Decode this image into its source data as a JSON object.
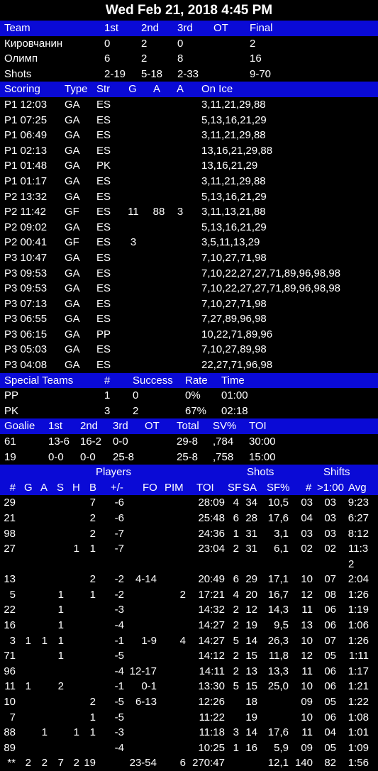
{
  "title": "Wed Feb 21, 2018 4:45 PM",
  "score": {
    "headers": [
      "Team",
      "1st",
      "2nd",
      "3rd",
      "OT",
      "Final"
    ],
    "rows": [
      [
        "Кировчанин",
        "0",
        "2",
        "0",
        "",
        "2"
      ],
      [
        "Олимп",
        "6",
        "2",
        "8",
        "",
        "16"
      ],
      [
        "Shots",
        "2-19",
        "5-18",
        "2-33",
        "",
        "9-70"
      ]
    ]
  },
  "scoring": {
    "headers": [
      "Scoring",
      "Type",
      "Str",
      "G",
      "A",
      "A",
      "On Ice"
    ],
    "rows": [
      [
        "P1 12:03",
        "GA",
        "ES",
        "",
        "",
        "",
        "3,11,21,29,88"
      ],
      [
        "P1 07:25",
        "GA",
        "ES",
        "",
        "",
        "",
        "5,13,16,21,29"
      ],
      [
        "P1 06:49",
        "GA",
        "ES",
        "",
        "",
        "",
        "3,11,21,29,88"
      ],
      [
        "P1 02:13",
        "GA",
        "ES",
        "",
        "",
        "",
        "13,16,21,29,88"
      ],
      [
        "P1 01:48",
        "GA",
        "PK",
        "",
        "",
        "",
        "13,16,21,29"
      ],
      [
        "P1 01:17",
        "GA",
        "ES",
        "",
        "",
        "",
        "3,11,21,29,88"
      ],
      [
        "P2 13:32",
        "GA",
        "ES",
        "",
        "",
        "",
        "5,13,16,21,29"
      ],
      [
        "P2 11:42",
        "GF",
        "ES",
        "11",
        "88",
        "3",
        "3,11,13,21,88"
      ],
      [
        "P2 09:02",
        "GA",
        "ES",
        "",
        "",
        "",
        "5,13,16,21,29"
      ],
      [
        "P2 00:41",
        "GF",
        "ES",
        "3",
        "",
        "",
        "3,5,11,13,29"
      ],
      [
        "P3 10:47",
        "GA",
        "ES",
        "",
        "",
        "",
        "7,10,27,71,98"
      ],
      [
        "P3 09:53",
        "GA",
        "ES",
        "",
        "",
        "",
        "7,10,22,27,27,71,89,96,98,98"
      ],
      [
        "P3 09:53",
        "GA",
        "ES",
        "",
        "",
        "",
        "7,10,22,27,27,71,89,96,98,98"
      ],
      [
        "P3 07:13",
        "GA",
        "ES",
        "",
        "",
        "",
        "7,10,27,71,98"
      ],
      [
        "P3 06:55",
        "GA",
        "ES",
        "",
        "",
        "",
        "7,27,89,96,98"
      ],
      [
        "P3 06:15",
        "GA",
        "PP",
        "",
        "",
        "",
        "10,22,71,89,96"
      ],
      [
        "P3 05:03",
        "GA",
        "ES",
        "",
        "",
        "",
        "7,10,27,89,98"
      ],
      [
        "P3 04:08",
        "GA",
        "ES",
        "",
        "",
        "",
        "22,27,71,96,98"
      ]
    ]
  },
  "special": {
    "headers": [
      "Special Teams",
      "#",
      "Success",
      "Rate",
      "Time"
    ],
    "rows": [
      [
        "PP",
        "1",
        "0",
        "0%",
        "01:00"
      ],
      [
        "PK",
        "3",
        "2",
        "67%",
        "02:18"
      ]
    ]
  },
  "goalies": {
    "headers": [
      "Goalie",
      "1st",
      "2nd",
      "3rd",
      "OT",
      "Total",
      "SV%",
      "TOI"
    ],
    "rows": [
      [
        "61",
        "13-6",
        "16-2",
        "0-0",
        "",
        "29-8",
        ",784",
        "30:00"
      ],
      [
        "19",
        "0-0",
        "0-0",
        "25-8",
        "",
        "25-8",
        ",758",
        "15:00"
      ]
    ]
  },
  "players": {
    "group_headers": [
      "Players",
      "Shots",
      "Shifts"
    ],
    "headers": [
      "#",
      "G",
      "A",
      "S",
      "H",
      "B",
      "+/-",
      "FO",
      "PIM",
      "TOI",
      "SF",
      "SA",
      "SF%",
      "#",
      ">1:00",
      "Avg"
    ],
    "rows": [
      [
        "29",
        "",
        "",
        "",
        "",
        "7",
        "-6",
        "",
        "",
        "28:09",
        "4",
        "34",
        "10,5",
        "03",
        "03",
        "9:23"
      ],
      [
        "21",
        "",
        "",
        "",
        "",
        "2",
        "-6",
        "",
        "",
        "25:48",
        "6",
        "28",
        "17,6",
        "04",
        "03",
        "6:27"
      ],
      [
        "98",
        "",
        "",
        "",
        "",
        "2",
        "-7",
        "",
        "",
        "24:36",
        "1",
        "31",
        "3,1",
        "03",
        "03",
        "8:12"
      ],
      [
        "27",
        "",
        "",
        "",
        "1",
        "1",
        "-7",
        "",
        "",
        "23:04",
        "2",
        "31",
        "6,1",
        "02",
        "02",
        "11:32"
      ],
      [
        "13",
        "",
        "",
        "",
        "",
        "2",
        "-2",
        "4-14",
        "",
        "20:49",
        "6",
        "29",
        "17,1",
        "10",
        "07",
        "2:04"
      ],
      [
        "5",
        "",
        "",
        "1",
        "",
        "1",
        "-2",
        "",
        "2",
        "17:21",
        "4",
        "20",
        "16,7",
        "12",
        "08",
        "1:26"
      ],
      [
        "22",
        "",
        "",
        "1",
        "",
        "",
        "-3",
        "",
        "",
        "14:32",
        "2",
        "12",
        "14,3",
        "11",
        "06",
        "1:19"
      ],
      [
        "16",
        "",
        "",
        "1",
        "",
        "",
        "-4",
        "",
        "",
        "14:27",
        "2",
        "19",
        "9,5",
        "13",
        "06",
        "1:06"
      ],
      [
        "3",
        "1",
        "1",
        "1",
        "",
        "",
        "-1",
        "1-9",
        "4",
        "14:27",
        "5",
        "14",
        "26,3",
        "10",
        "07",
        "1:26"
      ],
      [
        "71",
        "",
        "",
        "1",
        "",
        "",
        "-5",
        "",
        "",
        "14:12",
        "2",
        "15",
        "11,8",
        "12",
        "05",
        "1:11"
      ],
      [
        "96",
        "",
        "",
        "",
        "",
        "",
        "-4",
        "12-17",
        "",
        "14:11",
        "2",
        "13",
        "13,3",
        "11",
        "06",
        "1:17"
      ],
      [
        "11",
        "1",
        "",
        "2",
        "",
        "",
        "-1",
        "0-1",
        "",
        "13:30",
        "5",
        "15",
        "25,0",
        "10",
        "06",
        "1:21"
      ],
      [
        "10",
        "",
        "",
        "",
        "",
        "2",
        "-5",
        "6-13",
        "",
        "12:26",
        "",
        "18",
        "",
        "09",
        "05",
        "1:22"
      ],
      [
        "7",
        "",
        "",
        "",
        "",
        "1",
        "-5",
        "",
        "",
        "11:22",
        "",
        "19",
        "",
        "10",
        "06",
        "1:08"
      ],
      [
        "88",
        "",
        "1",
        "",
        "1",
        "1",
        "-3",
        "",
        "",
        "11:18",
        "3",
        "14",
        "17,6",
        "11",
        "04",
        "1:01"
      ],
      [
        "89",
        "",
        "",
        "",
        "",
        "",
        "-4",
        "",
        "",
        "10:25",
        "1",
        "16",
        "5,9",
        "09",
        "05",
        "1:09"
      ],
      [
        "**",
        "2",
        "2",
        "7",
        "2",
        "19",
        "",
        "23-54",
        "6",
        "270:47",
        "",
        "",
        "12,1",
        "140",
        "82",
        "1:56"
      ]
    ]
  }
}
